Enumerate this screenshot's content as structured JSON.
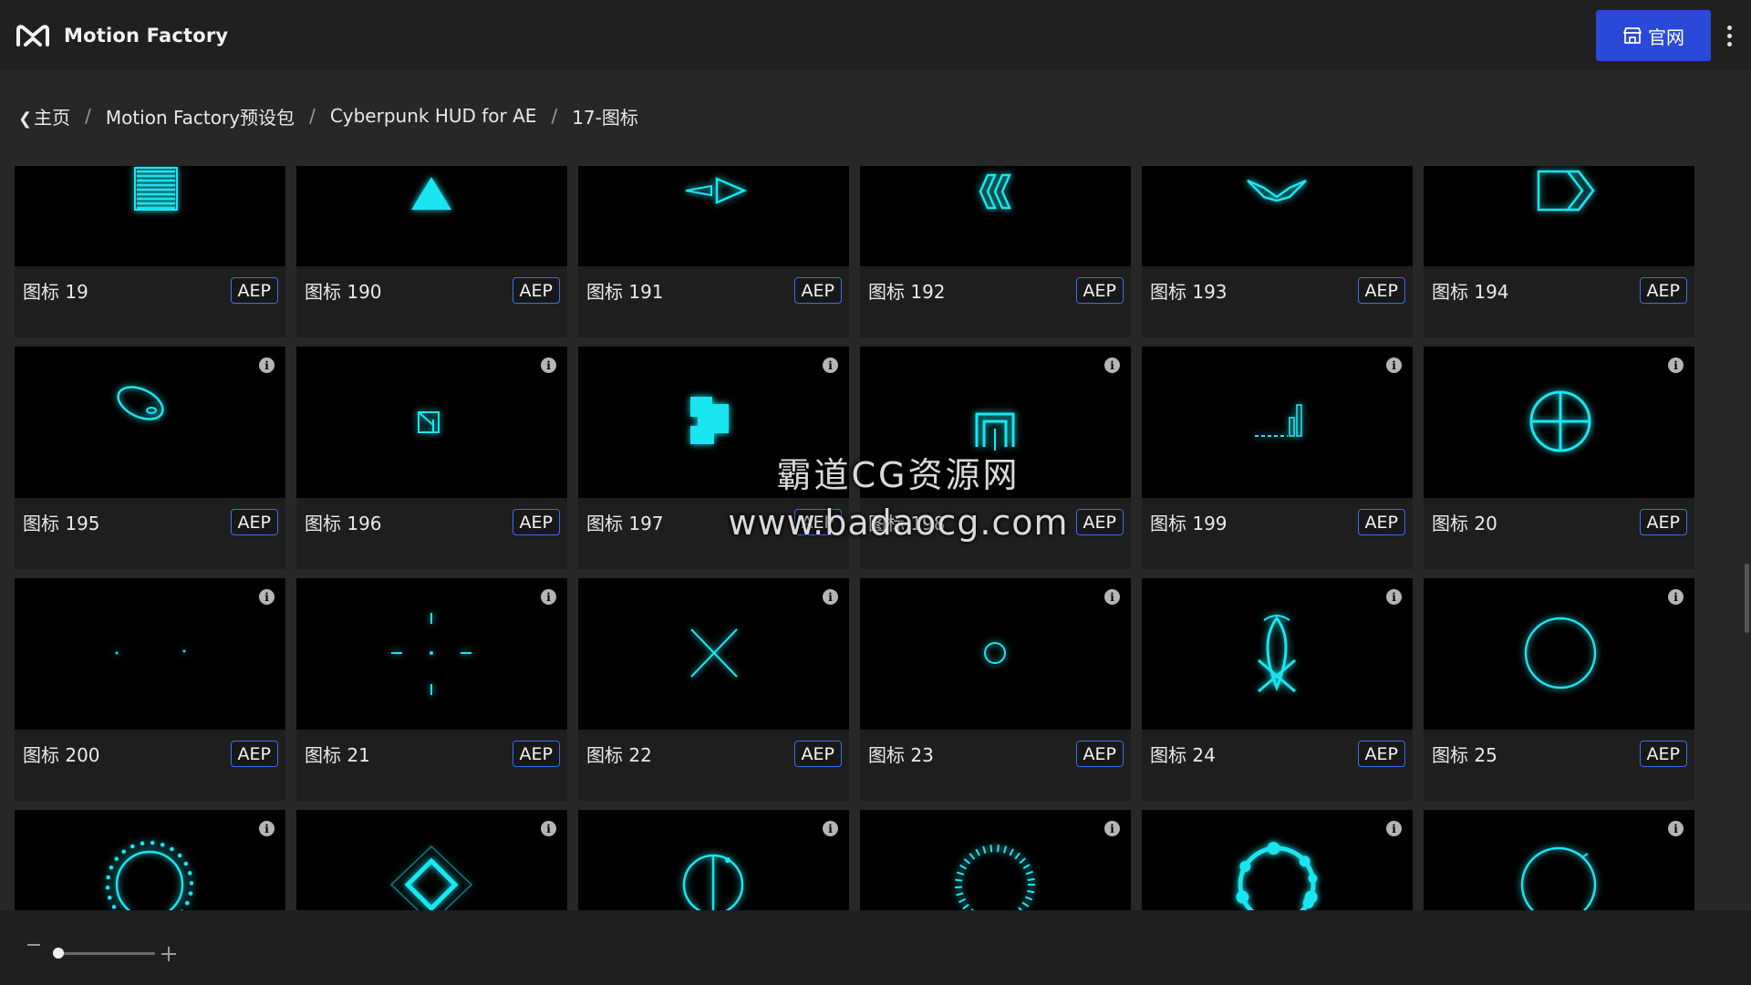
{
  "app": {
    "title": "Motion Factory",
    "logo_icon": "motion-factory-logo-icon",
    "site_button": "官网",
    "accent": "#2a49d8",
    "glow": "#19e6f0"
  },
  "breadcrumb": {
    "home": "主页",
    "items": [
      "Motion Factory预设包",
      "Cyberpunk HUD for AE",
      "17-图标"
    ],
    "separator": "/"
  },
  "cards": [
    {
      "name": "图标 19",
      "badge": "AEP",
      "icon": "striped-square"
    },
    {
      "name": "图标 190",
      "badge": "AEP",
      "icon": "triangle"
    },
    {
      "name": "图标 191",
      "badge": "AEP",
      "icon": "arrow-triangles"
    },
    {
      "name": "图标 192",
      "badge": "AEP",
      "icon": "double-chevron-left"
    },
    {
      "name": "图标 193",
      "badge": "AEP",
      "icon": "chevron-down"
    },
    {
      "name": "图标 194",
      "badge": "AEP",
      "icon": "arrow-tag"
    },
    {
      "name": "图标 195",
      "badge": "AEP",
      "icon": "ellipse"
    },
    {
      "name": "图标 196",
      "badge": "AEP",
      "icon": "small-box"
    },
    {
      "name": "图标 197",
      "badge": "AEP",
      "icon": "puzzle-block"
    },
    {
      "name": "图标 198",
      "badge": "AEP",
      "icon": "gate"
    },
    {
      "name": "图标 199",
      "badge": "AEP",
      "icon": "signal-bars"
    },
    {
      "name": "图标 20",
      "badge": "AEP",
      "icon": "crosshair-circle"
    },
    {
      "name": "图标 200",
      "badge": "AEP",
      "icon": "two-dots"
    },
    {
      "name": "图标 21",
      "badge": "AEP",
      "icon": "crosshair"
    },
    {
      "name": "图标 22",
      "badge": "AEP",
      "icon": "x-cross"
    },
    {
      "name": "图标 23",
      "badge": "AEP",
      "icon": "small-ring"
    },
    {
      "name": "图标 24",
      "badge": "AEP",
      "icon": "fish"
    },
    {
      "name": "图标 25",
      "badge": "AEP",
      "icon": "big-ring"
    },
    {
      "name": "",
      "badge": "",
      "icon": "dotted-ring"
    },
    {
      "name": "",
      "badge": "",
      "icon": "diamond"
    },
    {
      "name": "",
      "badge": "",
      "icon": "split-circle"
    },
    {
      "name": "",
      "badge": "",
      "icon": "tick-ring"
    },
    {
      "name": "",
      "badge": "",
      "icon": "bead-ring"
    },
    {
      "name": "",
      "badge": "",
      "icon": "thin-ring"
    }
  ],
  "watermark": {
    "line1": "霸道CG资源网",
    "line2": "www.badaocg.com"
  },
  "zoom": {
    "level": 0.05
  }
}
